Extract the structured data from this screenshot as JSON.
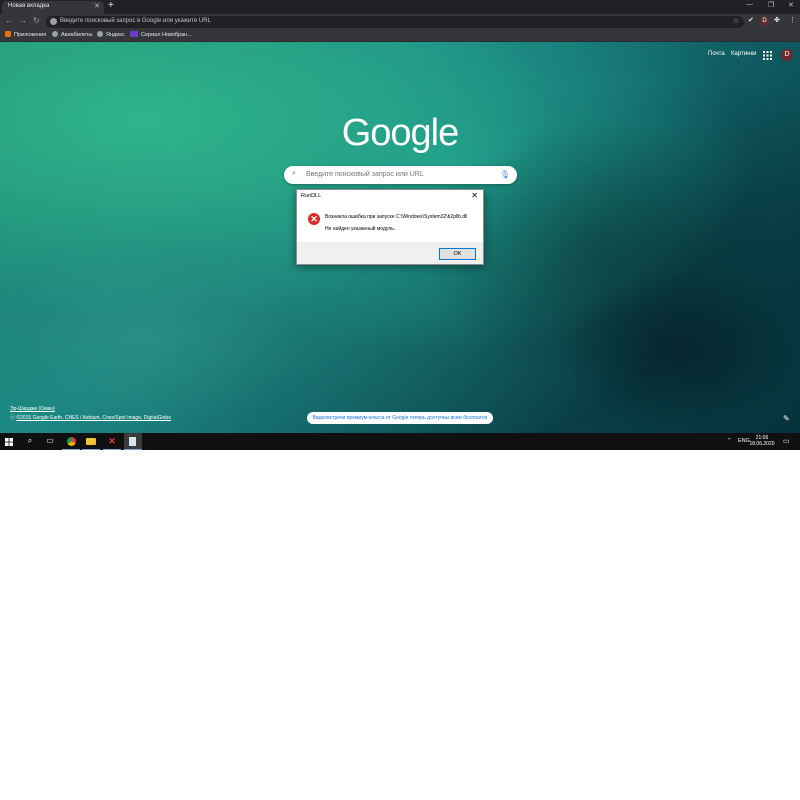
{
  "browser": {
    "tab_title": "Новая вкладка",
    "omnibox_placeholder": "Введите поисковый запрос в Google или укажите URL",
    "profile_initial": "D",
    "bookmarks": [
      {
        "label": "Приложения",
        "icon": "apps-grid-icon",
        "color": "#e8710a"
      },
      {
        "label": "Авиабилеты",
        "icon": "globe-icon",
        "color": "#9aa0a6"
      },
      {
        "label": "Яндекс",
        "icon": "globe-icon",
        "color": "#9aa0a6"
      },
      {
        "label": "Сериал Новобран...",
        "icon": "hd-icon",
        "color": "#6c3bd1"
      }
    ]
  },
  "ntp": {
    "links": [
      "Почта",
      "Картинки"
    ],
    "logo": "Google",
    "search_placeholder": "Введите поисковый запрос или URL",
    "attribution_title": "Эр-Шарджи (Оман)",
    "attribution_credit": "©2015 Google Earth, CNES / Astrium, Cnes/Spot Image, DigitalGlobe",
    "attribution_prefix": "ⓒ",
    "promo": "Видеовстречи премиум-класса от Google теперь доступны всем бесплатно",
    "avatar_initial": "D"
  },
  "dialog": {
    "title": "RunDLL",
    "message_line1": "Возникла ошибка при запуске C:\\Windows\\System32\\b2pllb.dll",
    "message_line2": "Не найден указанный модуль.",
    "ok_label": "OK"
  },
  "taskbar": {
    "language": "ENG",
    "time": "21:06",
    "date": "18.06.2020"
  }
}
